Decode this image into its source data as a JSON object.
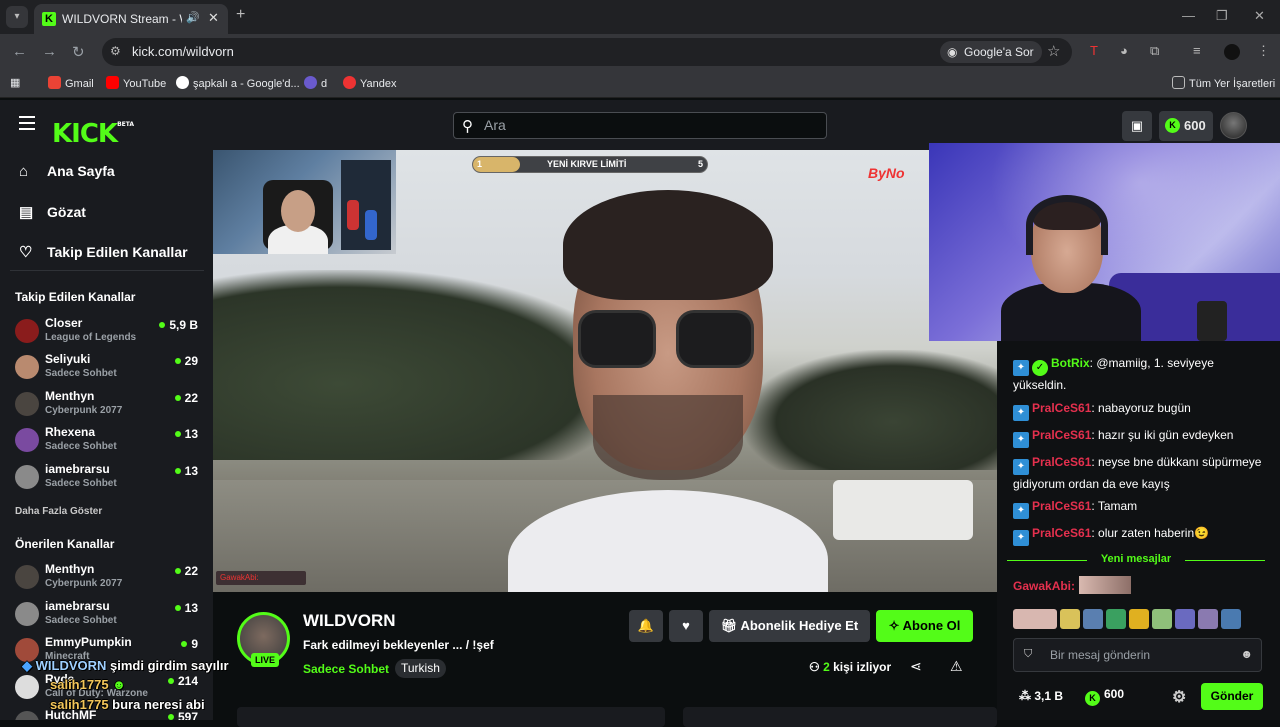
{
  "browser": {
    "tab_title": "WILDVORN Stream - Watch",
    "url": "kick.com/wildvorn",
    "google_sor": "Google'a Sor",
    "bookmarks": [
      "Gmail",
      "YouTube",
      "şapkalı a - Google'd...",
      "d",
      "Yandex"
    ],
    "all_bookmarks": "Tüm Yer İşaretleri"
  },
  "header": {
    "logo": "KICK",
    "beta": "BETA",
    "search_placeholder": "Ara",
    "kicks": "600"
  },
  "sidebar": {
    "nav": [
      "Ana Sayfa",
      "Gözat",
      "Takip Edilen Kanallar"
    ],
    "followed_title": "Takip Edilen Kanallar",
    "followed": [
      {
        "name": "Closer",
        "category": "League of Legends",
        "viewers": "5,9 B"
      },
      {
        "name": "Seliyuki",
        "category": "Sadece Sohbet",
        "viewers": "29"
      },
      {
        "name": "Menthyn",
        "category": "Cyberpunk 2077",
        "viewers": "22"
      },
      {
        "name": "Rhexena",
        "category": "Sadece Sohbet",
        "viewers": "13"
      },
      {
        "name": "iamebrarsu",
        "category": "Sadece Sohbet",
        "viewers": "13"
      }
    ],
    "show_more": "Daha Fazla Göster",
    "recommended_title": "Önerilen Kanallar",
    "recommended": [
      {
        "name": "Menthyn",
        "category": "Cyberpunk 2077",
        "viewers": "22"
      },
      {
        "name": "iamebrarsu",
        "category": "Sadece Sohbet",
        "viewers": "13"
      },
      {
        "name": "EmmyPumpkin",
        "category": "Minecraft",
        "viewers": "9"
      },
      {
        "name": "Ryde",
        "category": "Call of Duty: Warzone",
        "viewers": "214"
      },
      {
        "name": "HutchMF",
        "category": "",
        "viewers": "597"
      }
    ]
  },
  "video": {
    "kirve_title": "YENİ KIRVE LİMİTİ",
    "kirve_min": "1",
    "kirve_max": "5",
    "kirve_progress": 0.2,
    "watermark": "ByNo",
    "tag": "GawakAbi:"
  },
  "overlay_chat": [
    {
      "user": "WILDVORN",
      "text": "şimdi girdim sayılır"
    },
    {
      "user": "salih1775",
      "text": ""
    },
    {
      "user": "salih1775",
      "text": "bura neresi abi"
    }
  ],
  "stream": {
    "name": "WILDVORN",
    "live": "LIVE",
    "title": "Fark edilmeyi bekleyenler  ... / !şef",
    "category": "Sadece Sohbet",
    "tag": "Turkish",
    "gift_label": "Abonelik Hediye Et",
    "follow_label": "Abone Ol",
    "viewers_count": "2",
    "viewers_label": "kişi izliyor"
  },
  "chat": {
    "messages": [
      {
        "user": "BotRix",
        "text": "@mamiig, 1. seviyeye yükseldin."
      },
      {
        "user": "PralCeS61",
        "text": "nabayoruz bugün"
      },
      {
        "user": "PralCeS61",
        "text": "hazır şu iki gün evdeyken"
      },
      {
        "user": "PralCeS61",
        "text": "neyse bne dükkanı süpürmeye gidiyorum ordan da eve kayış"
      },
      {
        "user": "PralCeS61",
        "text": "Tamam"
      },
      {
        "user": "PralCeS61",
        "text": "olur zaten haberin😉"
      }
    ],
    "new_messages": "Yeni mesajlar",
    "last_user": "GawakAbi:",
    "input_placeholder": "Bir mesaj gönderin",
    "points": "3,1 B",
    "kicks": "600",
    "send": "Gönder"
  }
}
